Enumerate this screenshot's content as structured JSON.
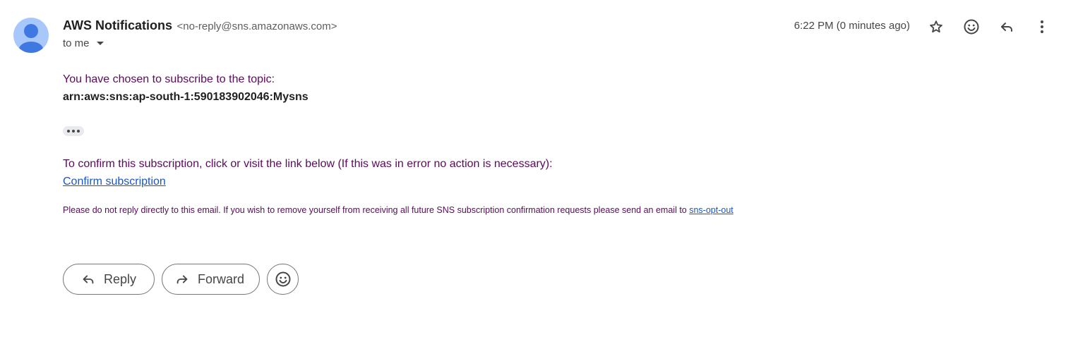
{
  "header": {
    "sender_name": "AWS Notifications",
    "sender_email": "<no-reply@sns.amazonaws.com>",
    "recipient": "to me",
    "timestamp": "6:22 PM (0 minutes ago)",
    "icons": [
      "star-icon",
      "emoji-react-icon",
      "reply-icon",
      "more-vert-icon"
    ]
  },
  "body": {
    "intro": "You have chosen to subscribe to the topic:",
    "topic_arn": "arn:aws:sns:ap-south-1:590183902046:Mysns",
    "confirm_instructions": "To confirm this subscription, click or visit the link below (If this was in error no action is necessary):",
    "confirm_link": "Confirm subscription",
    "footer_text": "Please do not reply directly to this email. If you wish to remove yourself from receiving all future SNS subscription confirmation requests please send an email to ",
    "optout_link": "sns-opt-out"
  },
  "actions": {
    "reply_label": "Reply",
    "forward_label": "Forward"
  },
  "colors": {
    "body_text": "#5b0a5b",
    "link": "#1a56c5",
    "avatar_bg": "#a8c7fa",
    "avatar_fg": "#3f78e0"
  }
}
